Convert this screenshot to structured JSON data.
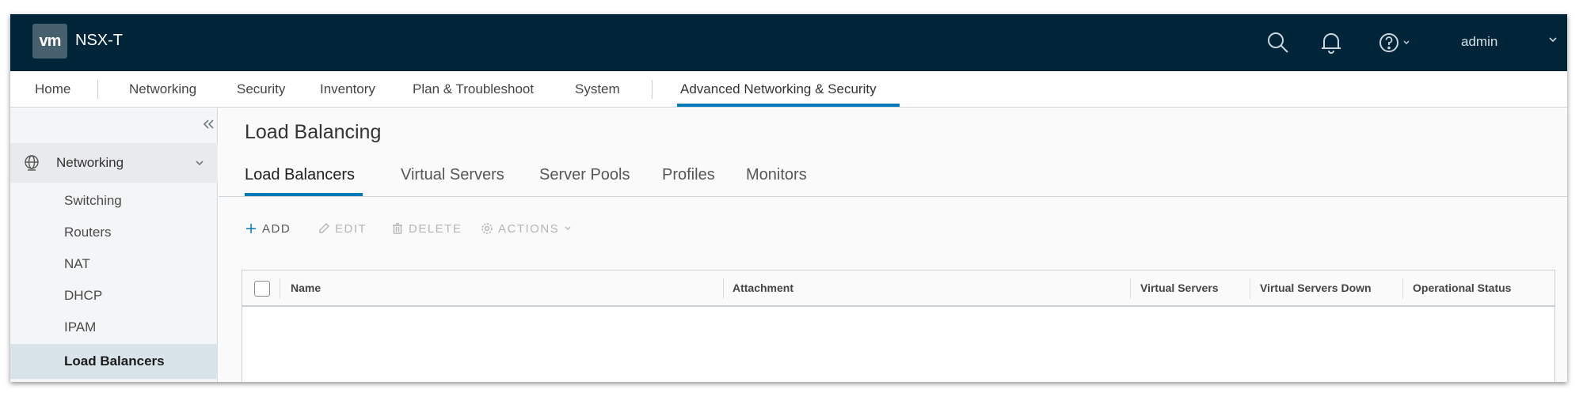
{
  "header": {
    "logo_text": "vm",
    "product": "NSX-T",
    "user": "admin",
    "icons": [
      "search-icon",
      "bell-icon",
      "help-icon",
      "chevron-down-icon"
    ]
  },
  "topnav": {
    "items": [
      "Home",
      "Networking",
      "Security",
      "Inventory",
      "Plan & Troubleshoot",
      "System",
      "Advanced Networking & Security"
    ],
    "active": "Advanced Networking & Security"
  },
  "sidebar": {
    "group": {
      "label": "Networking",
      "icon": "networking-icon",
      "expanded": true
    },
    "items": [
      "Switching",
      "Routers",
      "NAT",
      "DHCP",
      "IPAM",
      "Load Balancers"
    ],
    "active": "Load Balancers"
  },
  "main": {
    "title": "Load Balancing",
    "tabs": [
      "Load Balancers",
      "Virtual Servers",
      "Server Pools",
      "Profiles",
      "Monitors"
    ],
    "active_tab": "Load Balancers",
    "toolbar": {
      "add": "ADD",
      "edit": "EDIT",
      "delete": "DELETE",
      "actions": "ACTIONS"
    },
    "grid": {
      "columns": [
        "Name",
        "Attachment",
        "Virtual Servers",
        "Virtual Servers Down",
        "Operational Status"
      ],
      "rows": []
    }
  },
  "colors": {
    "header_bg": "#002538",
    "accent": "#0079b8",
    "sidebar_active": "#d9e4ea"
  }
}
